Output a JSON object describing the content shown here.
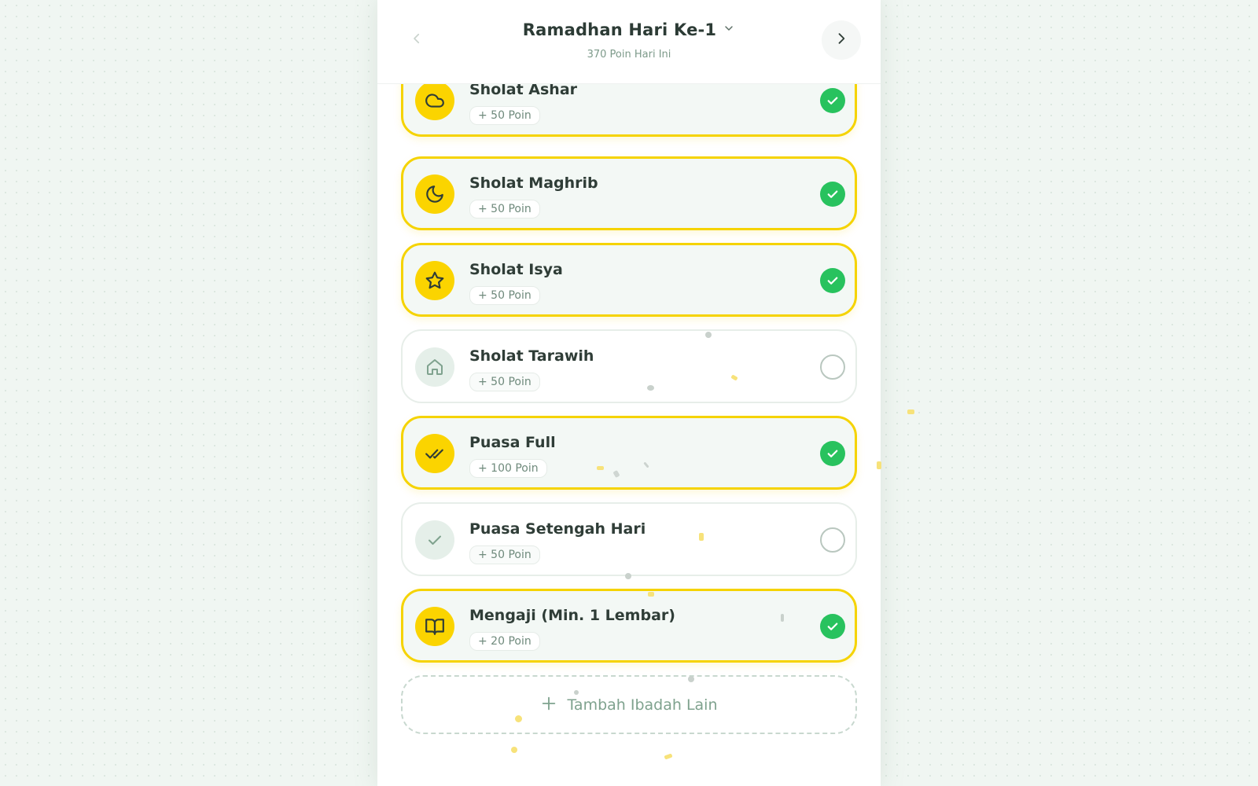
{
  "header": {
    "title": "Ramadhan Hari Ke-1",
    "subtitle": "370 Poin Hari Ini"
  },
  "items": [
    {
      "title": "Sholat Ashar",
      "points": "+ 50 Poin",
      "icon": "cloud-icon",
      "done": true
    },
    {
      "title": "Sholat Maghrib",
      "points": "+ 50 Poin",
      "icon": "moon-icon",
      "done": true
    },
    {
      "title": "Sholat Isya",
      "points": "+ 50 Poin",
      "icon": "star-icon",
      "done": true
    },
    {
      "title": "Sholat Tarawih",
      "points": "+ 50 Poin",
      "icon": "home-icon",
      "done": false
    },
    {
      "title": "Puasa Full",
      "points": "+ 100 Poin",
      "icon": "double-check-icon",
      "done": true
    },
    {
      "title": "Puasa Setengah Hari",
      "points": "+ 50 Poin",
      "icon": "check-icon",
      "done": false
    },
    {
      "title": "Mengaji (Min. 1 Lembar)",
      "points": "+ 20 Poin",
      "icon": "book-icon",
      "done": true
    }
  ],
  "add_button": {
    "label": "Tambah Ibadah Lain"
  },
  "colors": {
    "accent": "#f5d300",
    "success": "#28c25e",
    "muted": "#7fa28e"
  }
}
